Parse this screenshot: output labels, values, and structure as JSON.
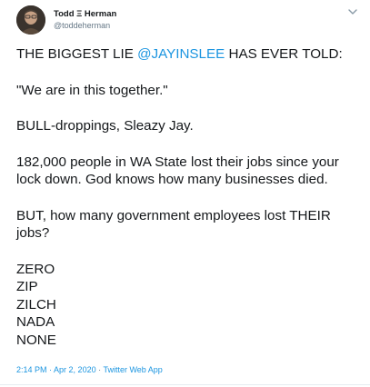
{
  "author": {
    "display_name": "Todd Ξ Herman",
    "handle": "@toddeherman"
  },
  "icons": {
    "avatar": "avatar-photo",
    "menu": "chevron-down-icon"
  },
  "colors": {
    "link": "#1b95e0",
    "text": "#14171a",
    "muted": "#657786"
  },
  "tweet": {
    "line1_prefix": "THE BIGGEST LIE ",
    "line1_mention": "@JAYINSLEE",
    "line1_suffix": " HAS EVER TOLD:",
    "quote": "\"We are in this together.\"",
    "retort": "BULL-droppings, Sleazy Jay.",
    "para3_line1": "182,000 people in WA State lost their jobs since your",
    "para3_line2": "lock down. God knows how many businesses died.",
    "para4_line1": "BUT, how many government employees lost THEIR",
    "para4_line2": "jobs?",
    "list": [
      "ZERO",
      "ZIP",
      "ZILCH",
      "NADA",
      "NONE"
    ]
  },
  "meta": {
    "time": "2:14 PM",
    "separator1": " · ",
    "date": "Apr 2, 2020",
    "separator2": " · ",
    "source": "Twitter Web App"
  }
}
